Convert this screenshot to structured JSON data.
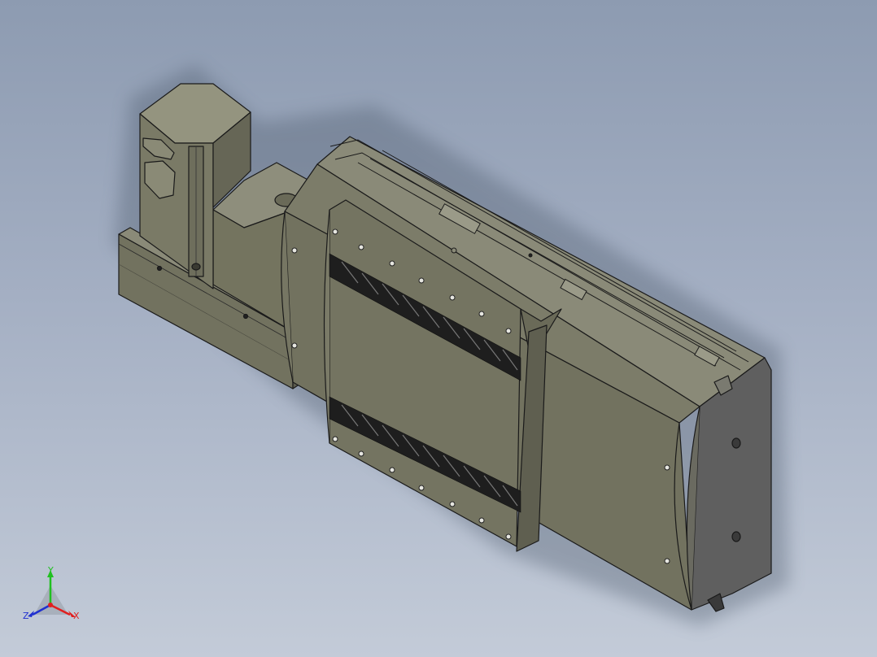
{
  "viewport": {
    "background_top": "#8d9bb1",
    "background_bottom": "#c3cbd8"
  },
  "model": {
    "body_color": "#7b7b6a",
    "shadow_color": "#5c5c50",
    "end_cap_color": "#5f5f5f",
    "belt_color": "#1e1e1e"
  },
  "triad": {
    "x_label": "X",
    "y_label": "Y",
    "z_label": "Z",
    "x_color": "#e02020",
    "y_color": "#20c020",
    "z_color": "#2030d0"
  }
}
